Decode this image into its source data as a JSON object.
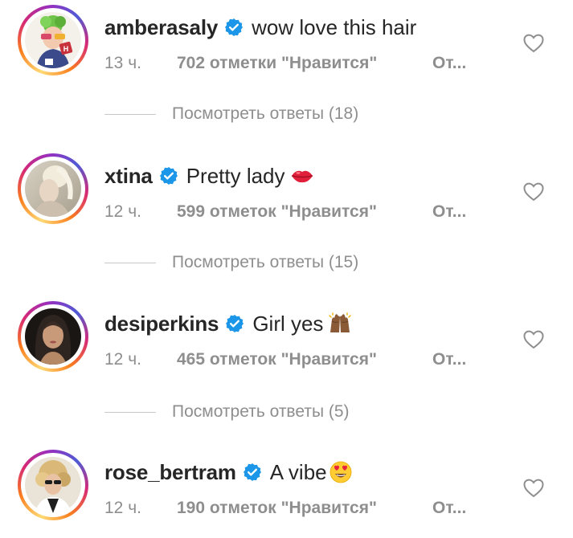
{
  "colors": {
    "text": "#262626",
    "secondary": "#8e8e8e",
    "verified": "#1c96e8",
    "divider": "#c7c7c7"
  },
  "comments": [
    {
      "username": "amberasaly",
      "verified": true,
      "text": "wow love this hair",
      "emoji": "",
      "time": "13 ч.",
      "likes": "702 отметки \"Нравится\"",
      "reply": "От...",
      "view_replies": "Посмотреть ответы (18)"
    },
    {
      "username": "xtina",
      "verified": true,
      "text": "Pretty lady",
      "emoji": "kiss-lips-icon",
      "time": "12 ч.",
      "likes": "599 отметок \"Нравится\"",
      "reply": "От...",
      "view_replies": "Посмотреть ответы (15)"
    },
    {
      "username": "desiperkins",
      "verified": true,
      "text": "Girl yes",
      "emoji": "raised-hands-icon",
      "time": "12 ч.",
      "likes": "465 отметок \"Нравится\"",
      "reply": "От...",
      "view_replies": "Посмотреть ответы (5)"
    },
    {
      "username": "rose_bertram",
      "verified": true,
      "text": "A vibe",
      "emoji": "heart-eyes-icon",
      "time": "12 ч.",
      "likes": "190 отметок \"Нравится\"",
      "reply": "От..."
    }
  ]
}
